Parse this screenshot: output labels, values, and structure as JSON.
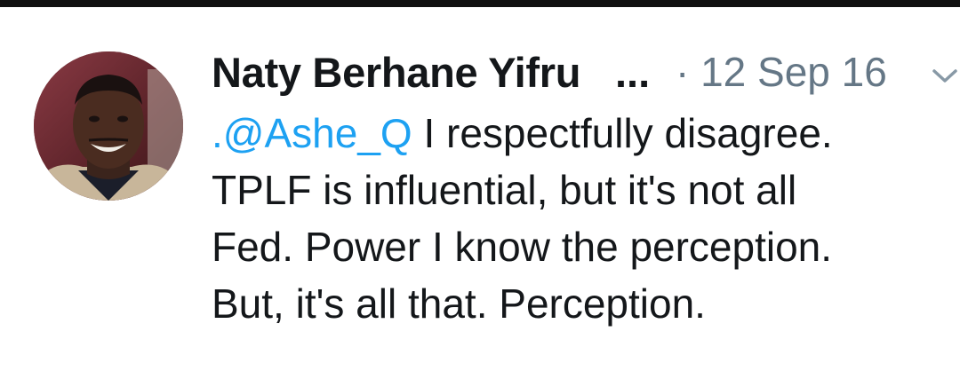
{
  "tweet": {
    "author": {
      "display_name": "Naty Berhane Yifru",
      "truncation": "..."
    },
    "timestamp": "· 12 Sep 16",
    "icons": {
      "avatar": "profile-photo",
      "menu": "chevron-down-icon"
    },
    "text": {
      "mention": ".@Ashe_Q",
      "line1_rest": " I respectfully disagree.",
      "line2": "TPLF is influential, but it's not all",
      "line3": "Fed. Power I know the perception.",
      "line4": "But, it's all that. Perception."
    },
    "colors": {
      "text": "#14171a",
      "meta": "#657786",
      "mention": "#1da1f2"
    }
  }
}
